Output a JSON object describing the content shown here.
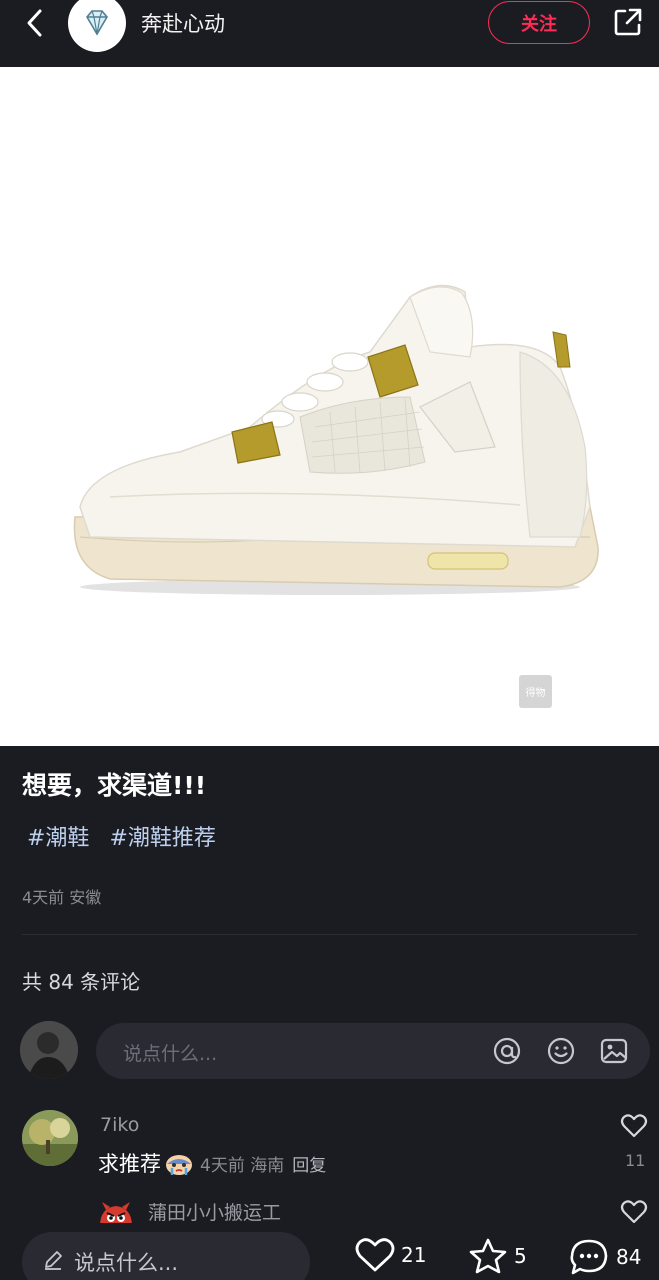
{
  "header": {
    "author_name": "奔赴心动",
    "follow_label": "关注",
    "icons": [
      "back-arrow-icon",
      "diamond-icon",
      "share-icon"
    ]
  },
  "image": {
    "description_icon": "sneaker-photo",
    "watermark": "得物"
  },
  "post": {
    "title": "想要，求渠道!!!",
    "tags": [
      "#潮鞋",
      "#潮鞋推荐"
    ],
    "meta": "4天前 安徽"
  },
  "comments_section": {
    "count_label": "共 84 条评论",
    "input_placeholder": "说点什么..."
  },
  "comments": [
    {
      "user": "7iko",
      "text": "求推荐",
      "time_location": "4天前 海南",
      "reply_label": "回复",
      "likes": "11"
    }
  ],
  "replies": [
    {
      "user": "蒲田小小搬运工"
    }
  ],
  "bottom_bar": {
    "input_placeholder": "说点什么...",
    "likes": "21",
    "stars": "5",
    "comments": "84"
  },
  "colors": {
    "background": "#1b1b22",
    "accent": "#ff2d55",
    "tag": "#bcd0ee"
  }
}
